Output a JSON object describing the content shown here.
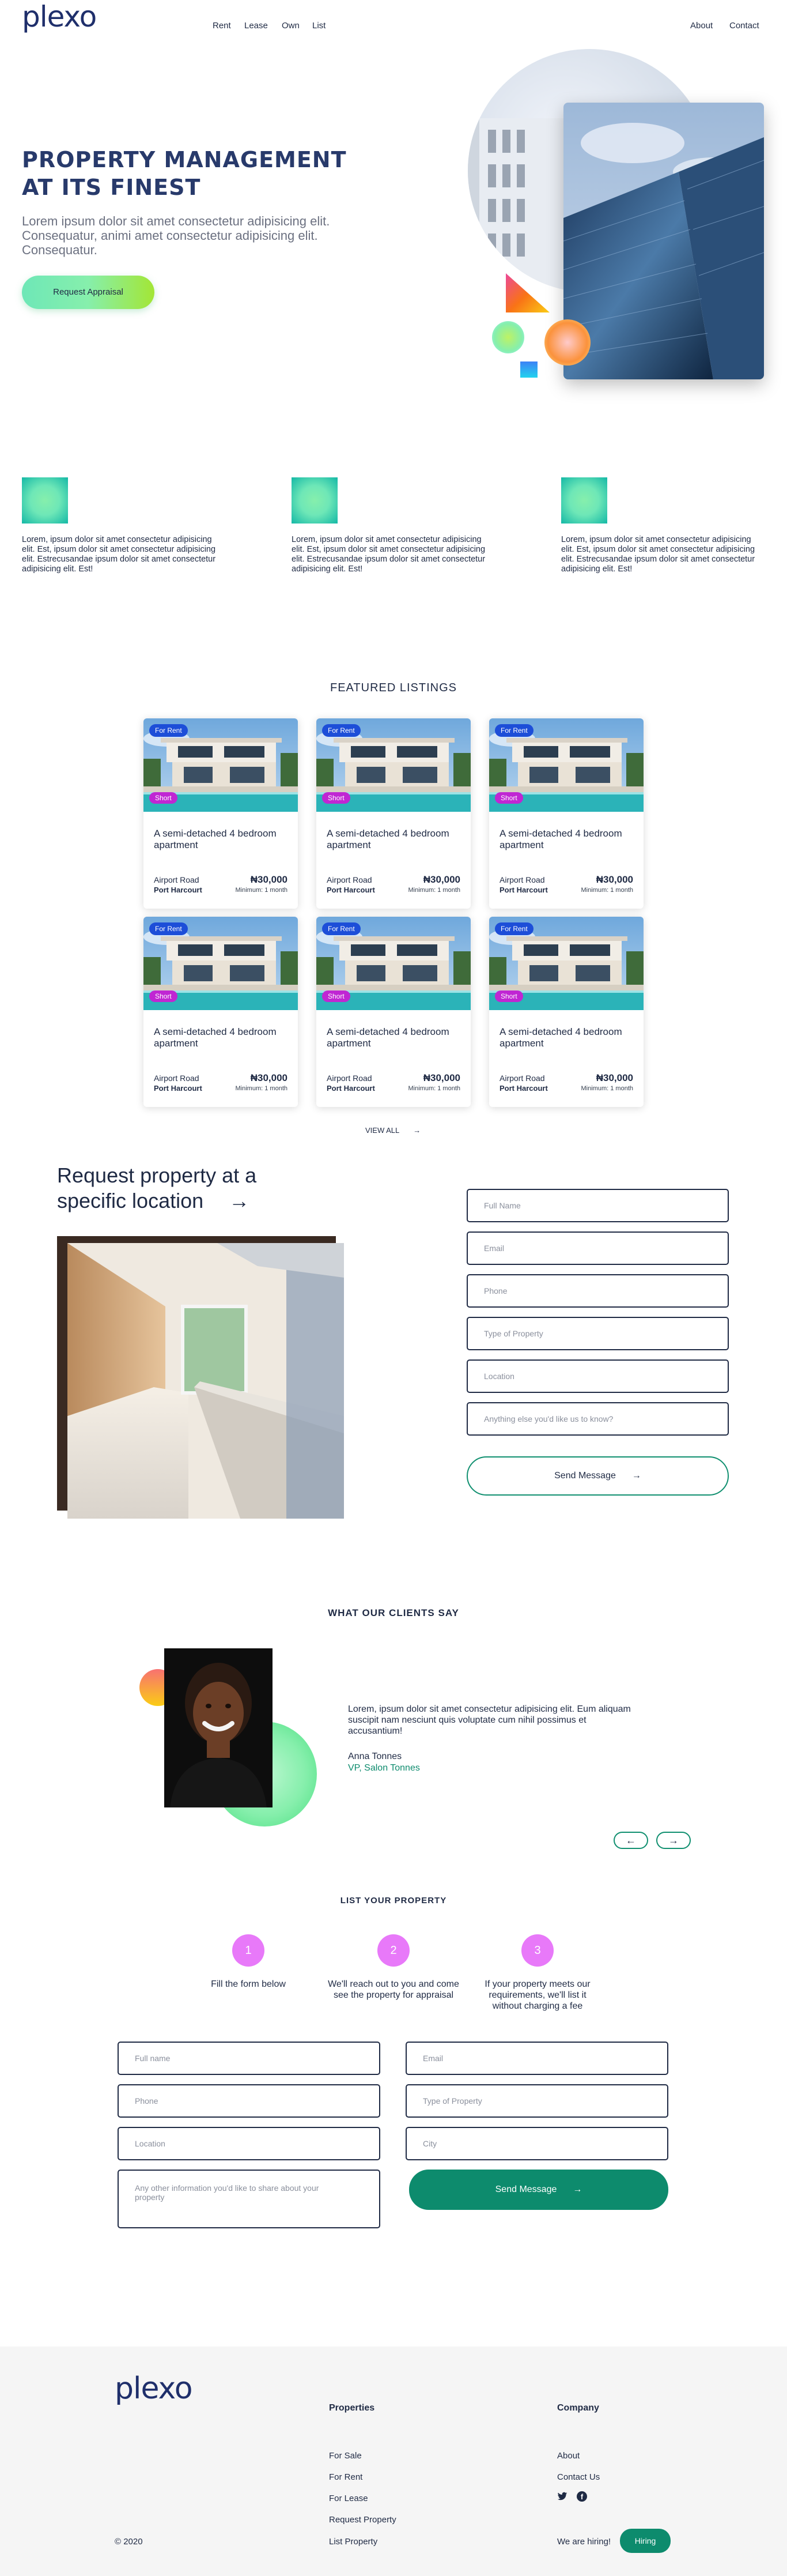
{
  "header": {
    "logo": "plexo",
    "nav_left": [
      "Rent",
      "Lease",
      "Own",
      "List"
    ],
    "nav_right": [
      "About",
      "Contact"
    ]
  },
  "hero": {
    "title_line1": "PROPERTY MANAGEMENT",
    "title_line2": "AT ITS FINEST",
    "subtitle": "Lorem ipsum dolor sit amet consectetur adipisicing elit. Consequatur, animi amet consectetur adipisicing elit. Consequatur.",
    "cta": "Request Appraisal"
  },
  "features": [
    {
      "text": "Lorem, ipsum dolor sit amet consectetur adipisicing elit. Est, ipsum dolor sit amet consectetur adipisicing elit. Estrecusandae ipsum dolor sit amet consectetur adipisicing elit. Est!"
    },
    {
      "text": "Lorem, ipsum dolor sit amet consectetur adipisicing elit. Est, ipsum dolor sit amet consectetur adipisicing elit. Estrecusandae ipsum dolor sit amet consectetur adipisicing elit. Est!"
    },
    {
      "text": "Lorem, ipsum dolor sit amet consectetur adipisicing elit. Est, ipsum dolor sit amet consectetur adipisicing elit. Estrecusandae ipsum dolor sit amet consectetur adipisicing elit. Est!"
    }
  ],
  "listings": {
    "title": "FEATURED LISTINGS",
    "view_all": "VIEW ALL",
    "cards": [
      {
        "badge": "For Rent",
        "tag": "Short",
        "title": "A semi-detached 4 bedroom apartment",
        "road": "Airport Road",
        "city": "Port Harcourt",
        "price": "₦30,000",
        "minimum": "Minimum: 1 month"
      },
      {
        "badge": "For Rent",
        "tag": "Short",
        "title": "A semi-detached 4 bedroom apartment",
        "road": "Airport Road",
        "city": "Port Harcourt",
        "price": "₦30,000",
        "minimum": "Minimum: 1 month"
      },
      {
        "badge": "For Rent",
        "tag": "Short",
        "title": "A semi-detached 4 bedroom apartment",
        "road": "Airport Road",
        "city": "Port Harcourt",
        "price": "₦30,000",
        "minimum": "Minimum: 1 month"
      },
      {
        "badge": "For Rent",
        "tag": "Short",
        "title": "A semi-detached 4 bedroom apartment",
        "road": "Airport Road",
        "city": "Port Harcourt",
        "price": "₦30,000",
        "minimum": "Minimum: 1 month"
      },
      {
        "badge": "For Rent",
        "tag": "Short",
        "title": "A semi-detached 4 bedroom apartment",
        "road": "Airport Road",
        "city": "Port Harcourt",
        "price": "₦30,000",
        "minimum": "Minimum: 1 month"
      },
      {
        "badge": "For Rent",
        "tag": "Short",
        "title": "A semi-detached 4 bedroom apartment",
        "road": "Airport Road",
        "city": "Port Harcourt",
        "price": "₦30,000",
        "minimum": "Minimum: 1 month"
      }
    ]
  },
  "request": {
    "title_line1": "Request property at a",
    "title_line2": "specific location",
    "fields": [
      "Full Name",
      "Email",
      "Phone",
      "Type of Property",
      "Location",
      "Anything else you'd like us to know?"
    ],
    "submit": "Send Message"
  },
  "testimonials": {
    "title": "WHAT OUR CLIENTS SAY",
    "quote": "Lorem, ipsum dolor sit amet consectetur adipisicing elit. Eum aliquam suscipit nam nesciunt quis voluptate cum nihil possimus et accusantium!",
    "name": "Anna Tonnes",
    "role": "VP, Salon Tonnes"
  },
  "list_property": {
    "title": "LIST YOUR PROPERTY",
    "steps": [
      {
        "num": "1",
        "text": "Fill the form below"
      },
      {
        "num": "2",
        "text": "We'll reach out to you and come see the property for appraisal"
      },
      {
        "num": "3",
        "text": "If your property meets our requirements, we'll list it without charging a fee"
      }
    ],
    "fields": {
      "full_name": "Full name",
      "email": "Email",
      "phone": "Phone",
      "type": "Type of Property",
      "location": "Location",
      "city": "City",
      "other": "Any other information you'd like to share about your property"
    },
    "submit": "Send Message"
  },
  "footer": {
    "logo": "plexo",
    "copyright": "© 2020",
    "properties_head": "Properties",
    "properties": [
      "For Sale",
      "For Rent",
      "For Lease",
      "Request Property",
      "List Property"
    ],
    "company_head": "Company",
    "company": [
      "About",
      "Contact Us"
    ],
    "hiring_text": "We are hiring!",
    "hiring_button": "Hiring"
  },
  "colors": {
    "brand": "#1f2f6b",
    "accent_green": "#0d8b6d",
    "badge_blue": "#1d4ed8",
    "badge_magenta": "#c026d3",
    "step_pink": "#e879f9"
  }
}
